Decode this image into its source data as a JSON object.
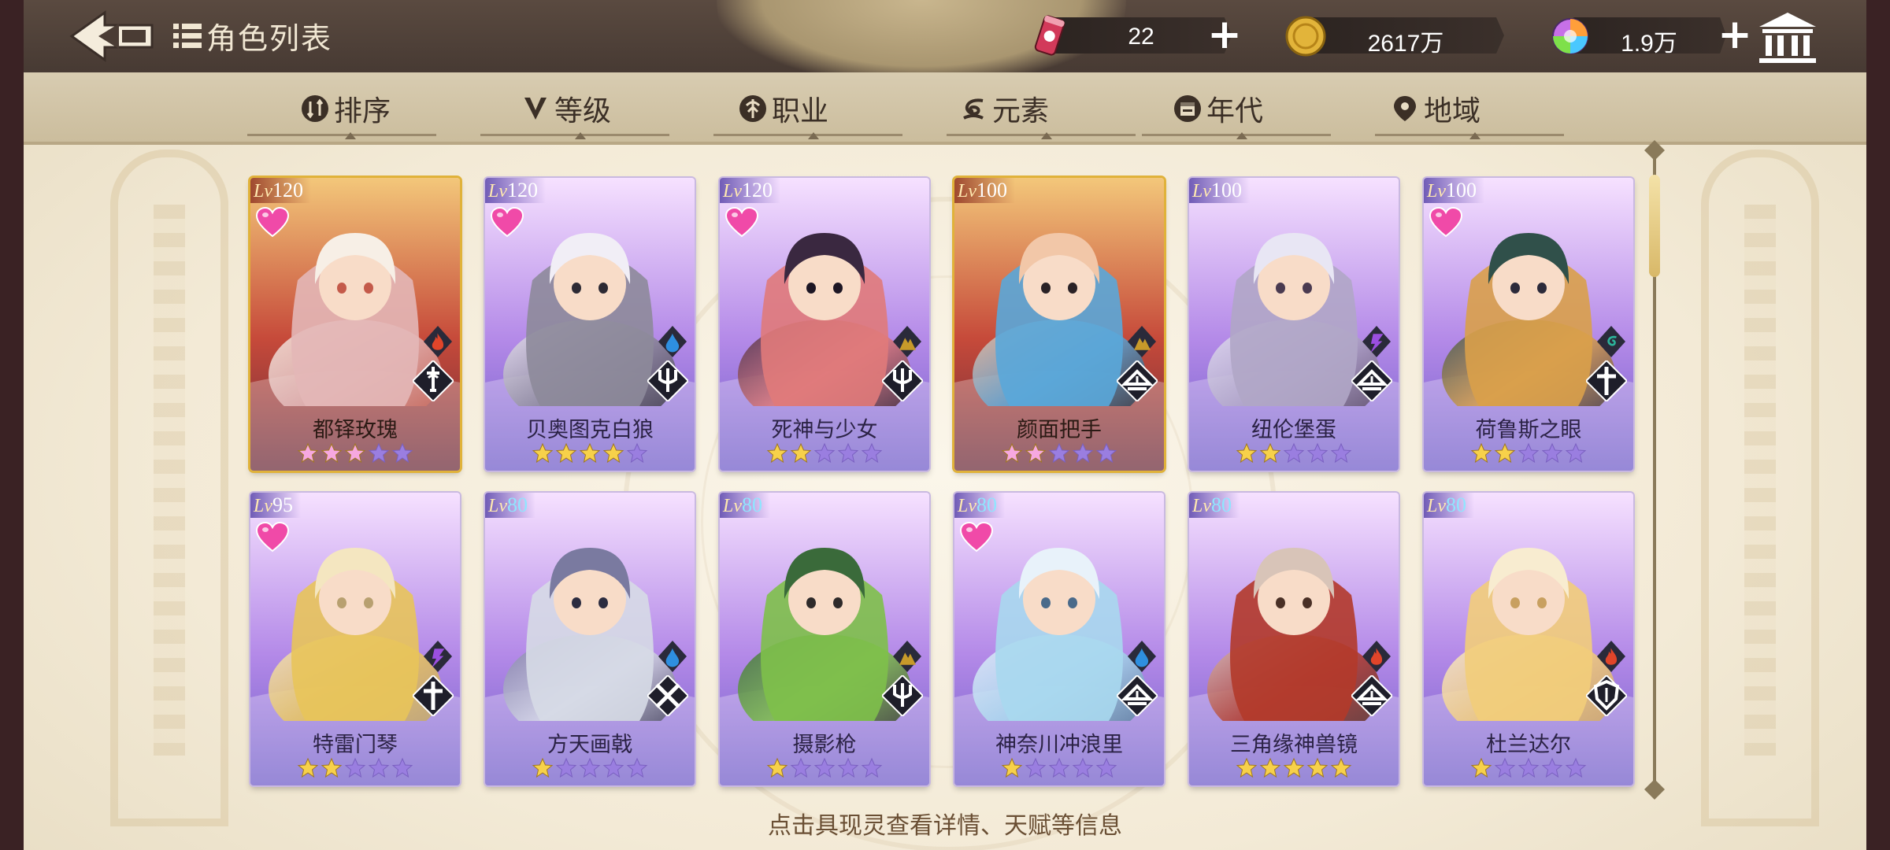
{
  "header": {
    "title": "角色列表",
    "resources": [
      {
        "name": "stamina",
        "value": "22",
        "icon": "can-icon",
        "color": "#d23a5a"
      },
      {
        "name": "gold",
        "value": "2617万",
        "icon": "coin-icon",
        "color": "#e2b43a"
      },
      {
        "name": "gems",
        "value": "1.9万",
        "icon": "rainbow-gem-icon",
        "color": "#c770e8"
      }
    ],
    "plus": "+"
  },
  "filters": [
    {
      "label": "排序",
      "icon": "sort-icon"
    },
    {
      "label": "等级",
      "icon": "level-v-icon"
    },
    {
      "label": "职业",
      "icon": "class-icon"
    },
    {
      "label": "元素",
      "icon": "element-icon"
    },
    {
      "label": "年代",
      "icon": "calendar-icon"
    },
    {
      "label": "地域",
      "icon": "location-pin-icon"
    }
  ],
  "level_prefix": "Lv",
  "cards": [
    {
      "name": "都铎玫瑰",
      "level": "120",
      "favorite": true,
      "stars": 3,
      "star_style": "pink",
      "element": "fire",
      "class": "sword",
      "theme": "gold"
    },
    {
      "name": "贝奥图克白狼",
      "level": "120",
      "favorite": true,
      "stars": 4,
      "star_style": "gold",
      "element": "water",
      "class": "trident",
      "theme": "purple"
    },
    {
      "name": "死神与少女",
      "level": "120",
      "favorite": true,
      "stars": 2,
      "star_style": "gold",
      "element": "earth",
      "class": "trident",
      "theme": "purple"
    },
    {
      "name": "颜面把手",
      "level": "100",
      "favorite": false,
      "stars": 2,
      "star_style": "pink",
      "element": "earth",
      "class": "book",
      "theme": "gold"
    },
    {
      "name": "纽伦堡蛋",
      "level": "100",
      "favorite": false,
      "stars": 2,
      "star_style": "gold",
      "element": "lightning",
      "class": "book",
      "theme": "purple"
    },
    {
      "name": "荷鲁斯之眼",
      "level": "100",
      "favorite": true,
      "stars": 2,
      "star_style": "gold",
      "element": "wind",
      "class": "cross",
      "theme": "purple"
    },
    {
      "name": "特雷门琴",
      "level": "95",
      "favorite": true,
      "stars": 2,
      "star_style": "gold",
      "element": "lightning",
      "class": "cross",
      "theme": "purple"
    },
    {
      "name": "方天画戟",
      "level": "80",
      "favorite": false,
      "stars": 1,
      "star_style": "gold",
      "element": "water",
      "class": "crossed-swords",
      "theme": "purple"
    },
    {
      "name": "摄影枪",
      "level": "80",
      "favorite": false,
      "stars": 1,
      "star_style": "gold",
      "element": "earth",
      "class": "trident",
      "theme": "purple"
    },
    {
      "name": "神奈川冲浪里",
      "level": "80",
      "favorite": true,
      "stars": 1,
      "star_style": "gold",
      "element": "water",
      "class": "book",
      "theme": "purple"
    },
    {
      "name": "三角缘神兽镜",
      "level": "80",
      "favorite": false,
      "stars": 5,
      "star_style": "gold",
      "element": "fire",
      "class": "book",
      "theme": "purple"
    },
    {
      "name": "杜兰达尔",
      "level": "80",
      "favorite": false,
      "stars": 1,
      "star_style": "gold",
      "element": "fire",
      "class": "shield",
      "theme": "purple"
    }
  ],
  "hint": "点击具现灵查看详情、天赋等信息",
  "colors": {
    "fire": "#e0452a",
    "water": "#2e8fe0",
    "earth": "#c79a2a",
    "lightning": "#9b4fe0",
    "wind": "#2bb39a"
  }
}
